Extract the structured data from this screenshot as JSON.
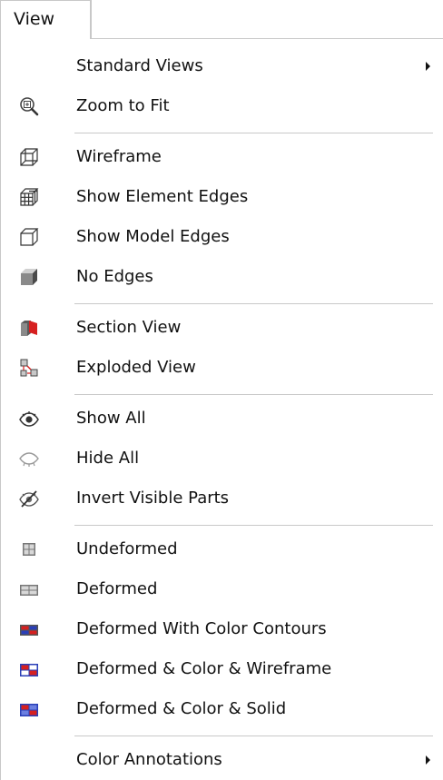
{
  "menubar": {
    "view_tab": "View"
  },
  "menu": {
    "items": [
      {
        "label": "Standard Views",
        "icon": "none",
        "submenu": true
      },
      {
        "label": "Zoom to Fit",
        "icon": "zoom-fit-icon"
      },
      {
        "label": "Wireframe",
        "icon": "wireframe-cube-icon"
      },
      {
        "label": "Show Element Edges",
        "icon": "element-edges-cube-icon"
      },
      {
        "label": "Show Model Edges",
        "icon": "model-edges-cube-icon"
      },
      {
        "label": "No Edges",
        "icon": "solid-cube-icon"
      },
      {
        "label": "Section View",
        "icon": "section-view-icon"
      },
      {
        "label": "Exploded View",
        "icon": "exploded-view-icon"
      },
      {
        "label": "Show All",
        "icon": "eye-open-icon"
      },
      {
        "label": "Hide All",
        "icon": "eye-outline-icon"
      },
      {
        "label": "Invert Visible Parts",
        "icon": "eye-crossed-icon"
      },
      {
        "label": "Undeformed",
        "icon": "undeformed-grid-icon"
      },
      {
        "label": "Deformed",
        "icon": "deformed-grid-icon"
      },
      {
        "label": "Deformed With Color Contours",
        "icon": "color-contours-grid-icon"
      },
      {
        "label": "Deformed & Color & Wireframe",
        "icon": "color-wireframe-grid-icon"
      },
      {
        "label": "Deformed & Color & Solid",
        "icon": "color-solid-grid-icon"
      },
      {
        "label": "Color Annotations",
        "icon": "none",
        "submenu": true
      }
    ]
  },
  "colors": {
    "separator": "#c9c9c9",
    "border": "#c8c8c8",
    "icon_gray": "#555555",
    "accent_red": "#d62020",
    "accent_blue": "#2a3fb8"
  }
}
